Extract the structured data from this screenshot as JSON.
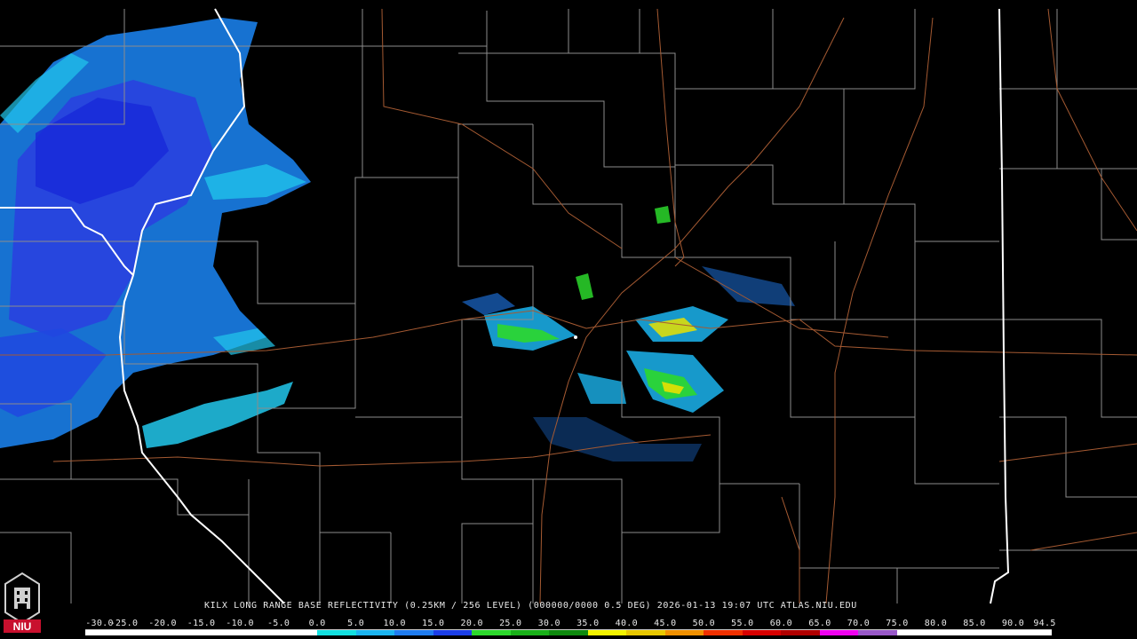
{
  "product": {
    "caption": "KILX LONG RANGE BASE REFLECTIVITY (0.25KM / 256 LEVEL) (000000/0000 0.5 DEG) 2026-01-13 19:07 UTC  ATLAS.NIU.EDU"
  },
  "logo": {
    "text": "NIU",
    "colors": {
      "red": "#c8102e",
      "silver": "#d0d0d0"
    }
  },
  "scale": {
    "labels": [
      "-30.0",
      "-25.0",
      "-20.0",
      "-15.0",
      "-10.0",
      "-5.0",
      "0.0",
      "5.0",
      "10.0",
      "15.0",
      "20.0",
      "25.0",
      "30.0",
      "35.0",
      "40.0",
      "45.0",
      "50.0",
      "55.0",
      "60.0",
      "65.0",
      "70.0",
      "75.0",
      "80.0",
      "85.0",
      "90.0",
      "94.5"
    ],
    "colors": [
      "#ffffff",
      "#ffffff",
      "#ffffff",
      "#ffffff",
      "#ffffff",
      "#ffffff",
      "#12e0e0",
      "#1ab4f0",
      "#1f7cf0",
      "#1b3ee8",
      "#2cd82c",
      "#18b018",
      "#0e8a0e",
      "#f4f400",
      "#e8c800",
      "#f09000",
      "#f03000",
      "#d80000",
      "#b00000",
      "#f000f0",
      "#9858c8",
      "#ffffff",
      "#ffffff",
      "#ffffff",
      "#ffffff"
    ]
  },
  "map_style": {
    "county_lines": "#8c8c8c",
    "highways": "#a55a32",
    "state_lines": "#ffffff"
  }
}
